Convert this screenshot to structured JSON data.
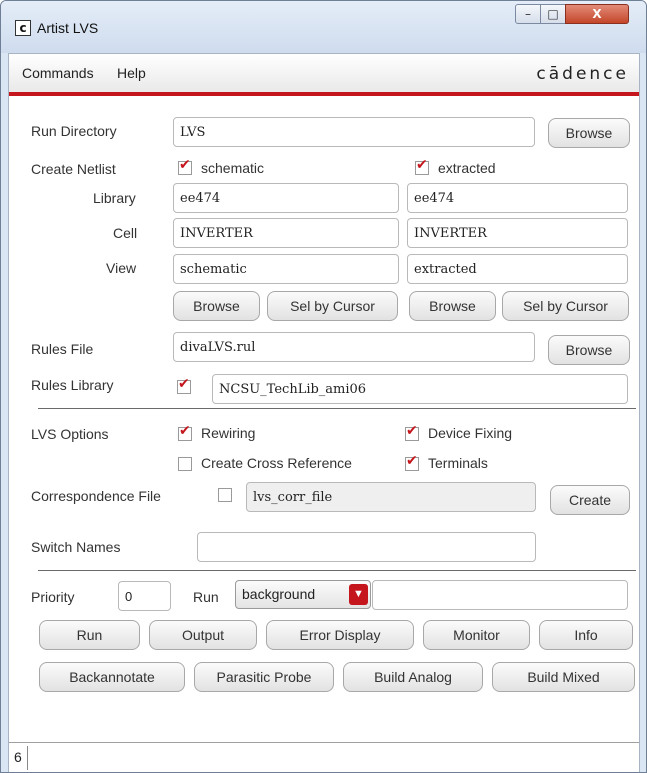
{
  "window": {
    "title": "Artist LVS",
    "min_glyph": "–",
    "max_glyph": "□",
    "close_glyph": "X",
    "app_icon_glyph": "c"
  },
  "menubar": {
    "items": [
      "Commands",
      "Help"
    ],
    "brand": "cādence"
  },
  "run_directory": {
    "label": "Run Directory",
    "value": "LVS",
    "browse": "Browse"
  },
  "netlist": {
    "label": "Create Netlist",
    "col1": {
      "checkbox_label": "schematic",
      "checked": true,
      "library": "ee474",
      "cell": "INVERTER",
      "view": "schematic"
    },
    "col2": {
      "checkbox_label": "extracted",
      "checked": true,
      "library": "ee474",
      "cell": "INVERTER",
      "view": "extracted"
    },
    "row_labels": {
      "library": "Library",
      "cell": "Cell",
      "view": "View"
    },
    "browse": "Browse",
    "sel_by_cursor": "Sel by Cursor"
  },
  "rules_file": {
    "label": "Rules File",
    "value": "divaLVS.rul",
    "browse": "Browse"
  },
  "rules_library": {
    "label": "Rules Library",
    "checked": true,
    "value": "NCSU_TechLib_ami06"
  },
  "lvs_options": {
    "label": "LVS Options",
    "rewiring": "Rewiring",
    "device_fixing": "Device Fixing",
    "create_cross_reference": "Create Cross Reference",
    "terminals": "Terminals"
  },
  "correspondence": {
    "label": "Correspondence File",
    "checked": false,
    "value": "lvs_corr_file",
    "create": "Create"
  },
  "switch_names": {
    "label": "Switch Names",
    "value": ""
  },
  "priority": {
    "label": "Priority",
    "value": "0",
    "run_label": "Run",
    "run_mode": "background",
    "run_extra": ""
  },
  "buttons": {
    "run": "Run",
    "output": "Output",
    "error_display": "Error Display",
    "monitor": "Monitor",
    "info": "Info",
    "backannotate": "Backannotate",
    "parasitic_probe": "Parasitic Probe",
    "build_analog": "Build Analog",
    "build_mixed": "Build Mixed"
  },
  "status": {
    "text": "6"
  },
  "colors": {
    "accent": "#c4161c",
    "title_bg": "#dbe6f4"
  }
}
